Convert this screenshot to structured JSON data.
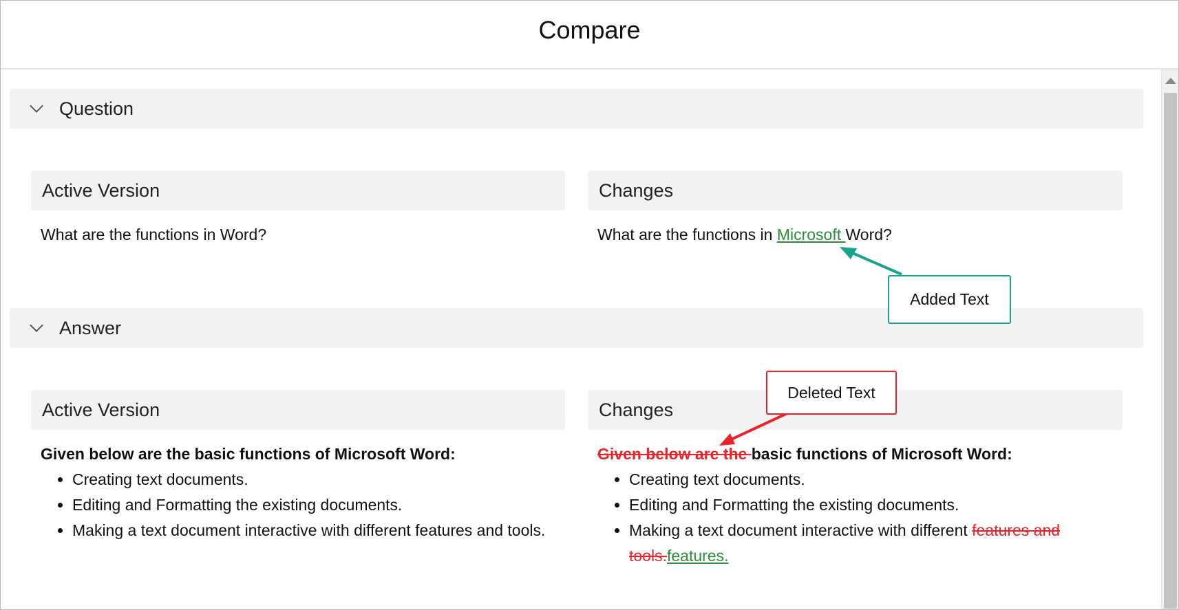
{
  "window": {
    "title": "Compare"
  },
  "question": {
    "section_label": "Question",
    "active": {
      "header": "Active Version",
      "text": "What are the functions in Word?"
    },
    "changes": {
      "header": "Changes",
      "text_before": "What are the functions in ",
      "text_added": "Microsoft ",
      "text_after": "Word?"
    }
  },
  "answer": {
    "section_label": "Answer",
    "active": {
      "header": "Active Version",
      "intro": "Given below are the basic functions of Microsoft Word:",
      "items": [
        "Creating text documents.",
        "Editing and Formatting the existing documents.",
        "Making a text document interactive with different features and tools."
      ]
    },
    "changes": {
      "header": "Changes",
      "intro_deleted": "Given below are the ",
      "intro_kept": "basic functions of Microsoft Word:",
      "items": [
        "Creating text documents.",
        "Editing and Formatting the existing documents."
      ],
      "item3_kept": "Making a text document interactive with different ",
      "item3_deleted": "features and tools.",
      "item3_added": "features."
    }
  },
  "callouts": {
    "added_label": "Added Text",
    "deleted_label": "Deleted Text"
  },
  "colors": {
    "added": "#2e8b3e",
    "deleted": "#e8232b",
    "added_callout": "#1aa38a"
  }
}
